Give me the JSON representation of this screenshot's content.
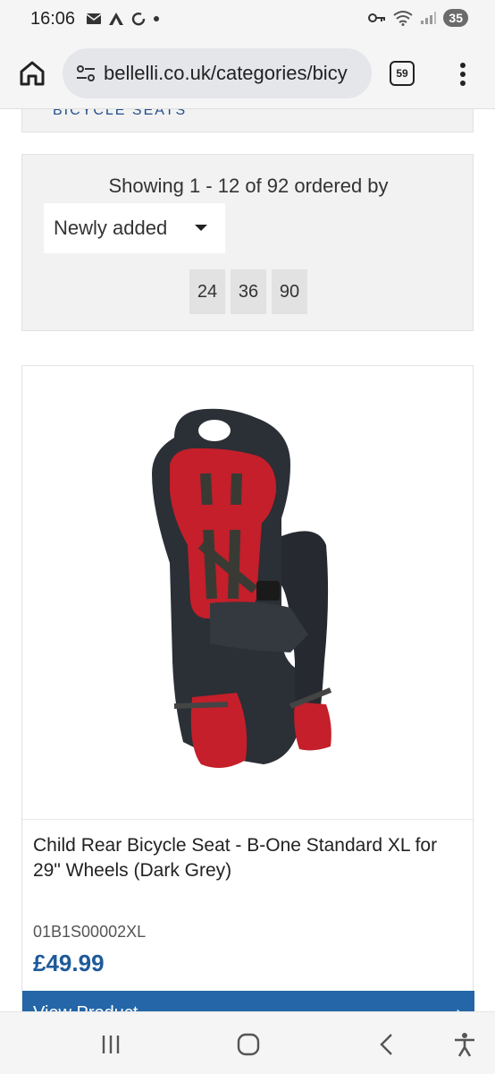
{
  "status_bar": {
    "time": "16:06",
    "battery": "35",
    "icons": [
      "mail-icon",
      "a-icon",
      "sync-icon",
      "dot-icon",
      "key-icon",
      "wifi-icon",
      "signal-icon"
    ]
  },
  "browser": {
    "url": "bellelli.co.uk/categories/bicy",
    "tab_count": "59"
  },
  "previous_section": {
    "label": "BICYCLE SEATS"
  },
  "sorting": {
    "showing_text": "Showing 1 - 12 of 92 ordered by",
    "order_selected": "Newly added",
    "per_page_options": [
      "24",
      "36",
      "90"
    ]
  },
  "product": {
    "name": "Child Rear Bicycle Seat - B-One Standard XL for 29\" Wheels (Dark Grey)",
    "sku": "01B1S00002XL",
    "price": "£49.99",
    "button_label": "View Product",
    "button_arrow": "›"
  },
  "colors": {
    "accent": "#2466a8",
    "price": "#1f5a9a",
    "seat_body": "#2b2f36",
    "seat_padding": "#c41f2a"
  }
}
